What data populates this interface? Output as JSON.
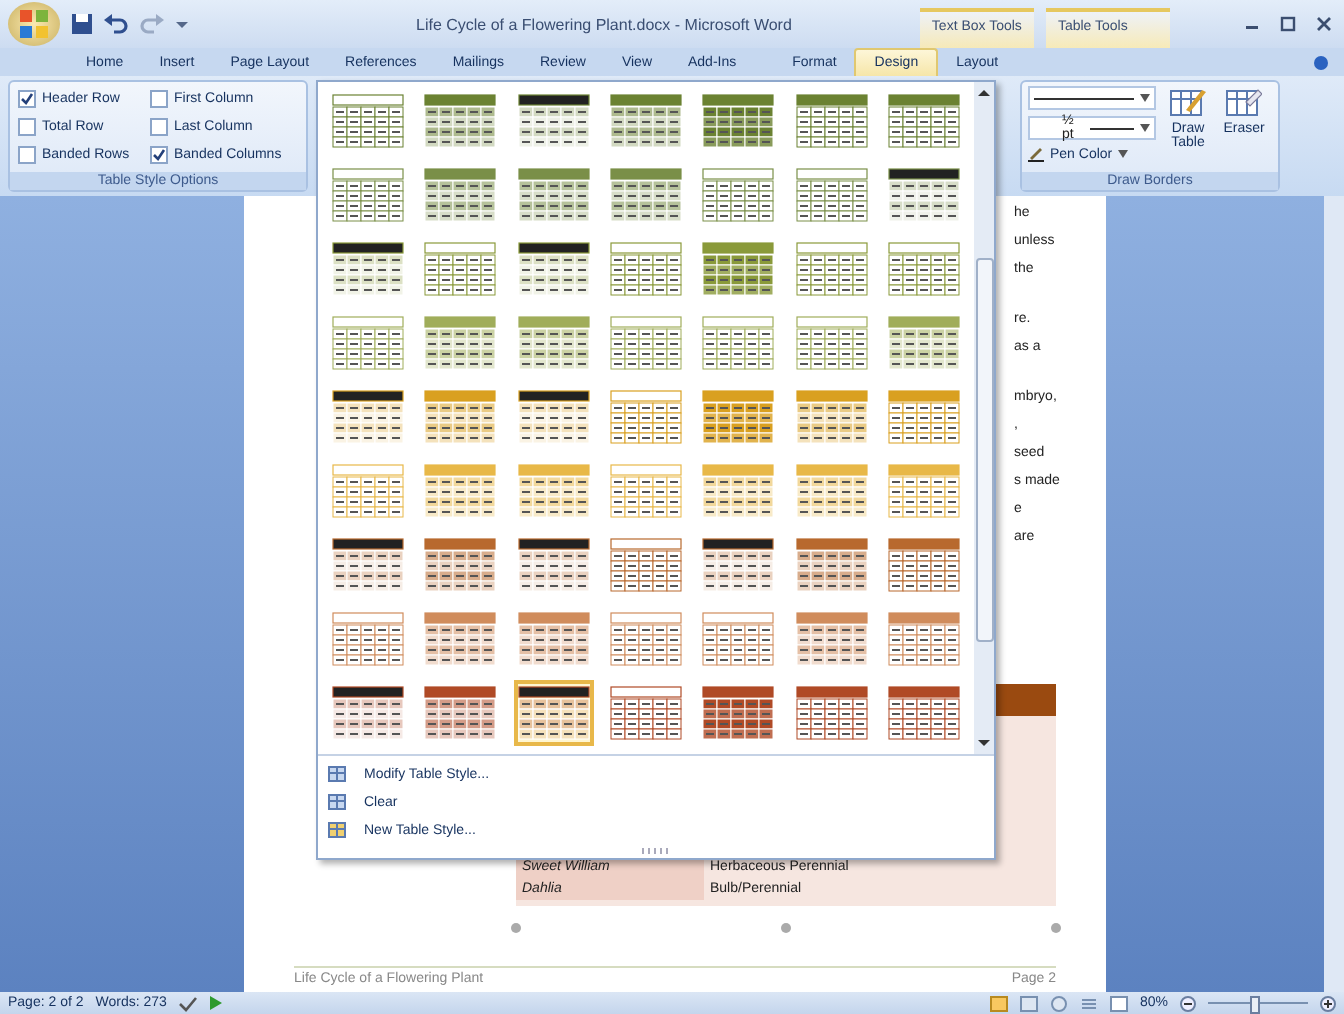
{
  "window": {
    "title": "Life Cycle of a Flowering Plant.docx - Microsoft Word",
    "contextual_tabs": [
      "Text Box Tools",
      "Table Tools"
    ]
  },
  "tabs": [
    {
      "label": "Home",
      "selected": false
    },
    {
      "label": "Insert",
      "selected": false
    },
    {
      "label": "Page Layout",
      "selected": false
    },
    {
      "label": "References",
      "selected": false
    },
    {
      "label": "Mailings",
      "selected": false
    },
    {
      "label": "Review",
      "selected": false
    },
    {
      "label": "View",
      "selected": false
    },
    {
      "label": "Add-Ins",
      "selected": false
    },
    {
      "label": "Format",
      "selected": false
    },
    {
      "label": "Design",
      "selected": true
    },
    {
      "label": "Layout",
      "selected": false
    }
  ],
  "table_style_options": {
    "label": "Table Style Options",
    "options": [
      {
        "label": "Header Row",
        "checked": true
      },
      {
        "label": "First Column",
        "checked": false
      },
      {
        "label": "Total Row",
        "checked": false
      },
      {
        "label": "Last Column",
        "checked": false
      },
      {
        "label": "Banded Rows",
        "checked": false
      },
      {
        "label": "Banded Columns",
        "checked": true
      }
    ]
  },
  "draw_borders": {
    "label": "Draw Borders",
    "weight": "½ pt",
    "pen_color": "Pen Color",
    "draw_table": "Draw Table",
    "eraser": "Eraser"
  },
  "gallery": {
    "rows": [
      {
        "color": "#6b8232",
        "items": [
          {
            "kind": "light",
            "selected": false
          },
          {
            "kind": "medium",
            "selected": false
          },
          {
            "kind": "header",
            "selected": false
          },
          {
            "kind": "medium",
            "selected": false
          },
          {
            "kind": "dark",
            "selected": false
          },
          {
            "kind": "grid",
            "selected": false
          },
          {
            "kind": "grid",
            "selected": false
          }
        ]
      },
      {
        "color": "#7a8f48",
        "items": [
          {
            "kind": "light",
            "selected": false
          },
          {
            "kind": "medium",
            "selected": false
          },
          {
            "kind": "medium",
            "selected": false
          },
          {
            "kind": "medium",
            "selected": false
          },
          {
            "kind": "light",
            "selected": false
          },
          {
            "kind": "light",
            "selected": false
          },
          {
            "kind": "header",
            "selected": false
          }
        ]
      },
      {
        "color": "#8a9a3a",
        "items": [
          {
            "kind": "header",
            "selected": false
          },
          {
            "kind": "light",
            "selected": false
          },
          {
            "kind": "header",
            "selected": false
          },
          {
            "kind": "light",
            "selected": false
          },
          {
            "kind": "dark",
            "selected": false
          },
          {
            "kind": "light",
            "selected": false
          },
          {
            "kind": "light",
            "selected": false
          }
        ]
      },
      {
        "color": "#a0ad5a",
        "items": [
          {
            "kind": "light",
            "selected": false
          },
          {
            "kind": "medium",
            "selected": false
          },
          {
            "kind": "medium",
            "selected": false
          },
          {
            "kind": "light",
            "selected": false
          },
          {
            "kind": "light",
            "selected": false
          },
          {
            "kind": "light",
            "selected": false
          },
          {
            "kind": "medium",
            "selected": false
          }
        ]
      },
      {
        "color": "#d9a020",
        "items": [
          {
            "kind": "header",
            "selected": false
          },
          {
            "kind": "medium",
            "selected": false
          },
          {
            "kind": "header",
            "selected": false
          },
          {
            "kind": "light",
            "selected": false
          },
          {
            "kind": "dark",
            "selected": false
          },
          {
            "kind": "medium",
            "selected": false
          },
          {
            "kind": "grid",
            "selected": false
          }
        ]
      },
      {
        "color": "#e8b848",
        "items": [
          {
            "kind": "light",
            "selected": false
          },
          {
            "kind": "medium",
            "selected": false
          },
          {
            "kind": "medium",
            "selected": false
          },
          {
            "kind": "light",
            "selected": false
          },
          {
            "kind": "medium",
            "selected": false
          },
          {
            "kind": "medium",
            "selected": false
          },
          {
            "kind": "grid",
            "selected": false
          }
        ]
      },
      {
        "color": "#b8692e",
        "items": [
          {
            "kind": "header",
            "selected": false
          },
          {
            "kind": "medium",
            "selected": false
          },
          {
            "kind": "header",
            "selected": false
          },
          {
            "kind": "light",
            "selected": false
          },
          {
            "kind": "header",
            "selected": false
          },
          {
            "kind": "medium",
            "selected": false
          },
          {
            "kind": "grid",
            "selected": false
          }
        ]
      },
      {
        "color": "#d08c5c",
        "items": [
          {
            "kind": "light",
            "selected": false
          },
          {
            "kind": "medium",
            "selected": false
          },
          {
            "kind": "medium",
            "selected": false
          },
          {
            "kind": "light",
            "selected": false
          },
          {
            "kind": "light",
            "selected": false
          },
          {
            "kind": "medium",
            "selected": false
          },
          {
            "kind": "grid",
            "selected": false
          }
        ]
      },
      {
        "color": "#b04a26",
        "items": [
          {
            "kind": "header",
            "selected": false
          },
          {
            "kind": "medium",
            "selected": false
          },
          {
            "kind": "header",
            "selected": true
          },
          {
            "kind": "light",
            "selected": false
          },
          {
            "kind": "dark",
            "selected": false
          },
          {
            "kind": "grid",
            "selected": false
          },
          {
            "kind": "grid",
            "selected": false
          }
        ]
      }
    ],
    "commands": [
      "Modify Table Style...",
      "Clear",
      "New Table Style..."
    ]
  },
  "document": {
    "paragraphs": [
      [
        "he",
        "unless",
        "the"
      ],
      [
        "re.",
        "as a"
      ],
      [
        "mbryo,",
        ",",
        "seed",
        "s made",
        "e",
        "are"
      ]
    ],
    "table_rows": [
      {
        "cells": [
          "Sweet William",
          "Herbaceous Perennial"
        ]
      },
      {
        "cells": [
          "Dahlia",
          "Bulb/Perennial"
        ]
      }
    ],
    "footer": {
      "title": "Life Cycle of a Flowering Plant",
      "page": "Page 2"
    }
  },
  "status_bar": {
    "page": "Page: 2 of 2",
    "words": "Words: 273",
    "zoom": "80%",
    "zoom_slider": {
      "level": 0.45
    }
  }
}
